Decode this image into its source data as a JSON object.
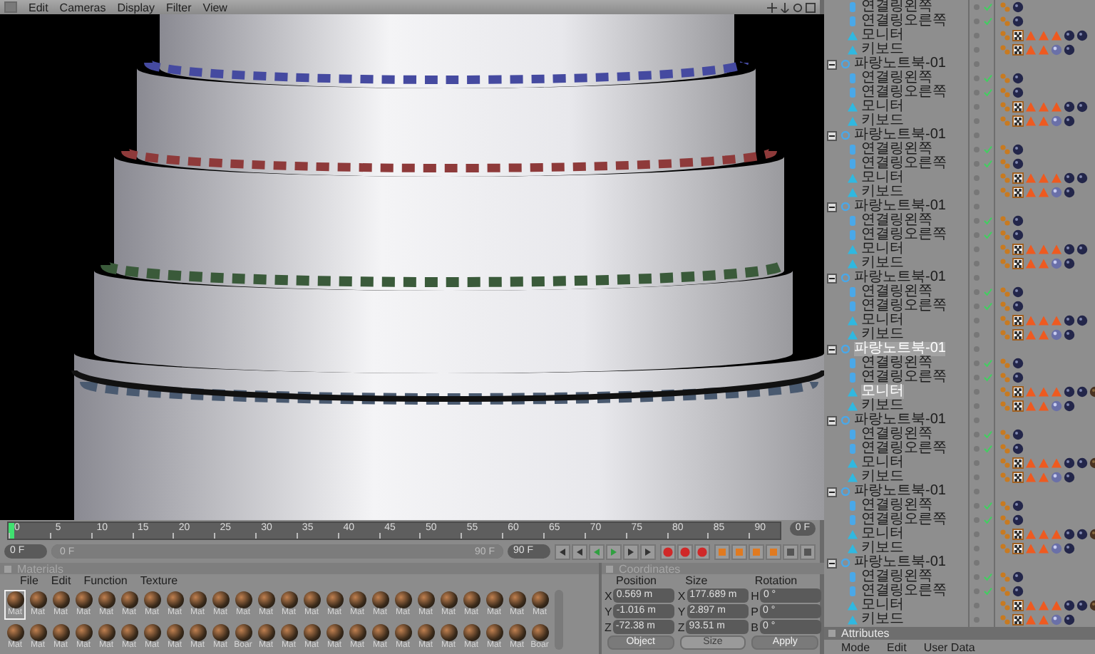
{
  "viewport": {
    "menu": [
      "Edit",
      "Cameras",
      "Display",
      "Filter",
      "View"
    ]
  },
  "timeline": {
    "ticks": [
      "0",
      "5",
      "10",
      "15",
      "20",
      "25",
      "30",
      "35",
      "40",
      "45",
      "50",
      "55",
      "60",
      "65",
      "70",
      "75",
      "80",
      "85",
      "90"
    ],
    "playhead": {
      "level": 0
    },
    "current_frame": "0 F",
    "start_field": "0 F",
    "range": {
      "start": "0 F",
      "end": "90 F",
      "level": 1
    },
    "end_field": "90 F"
  },
  "materials": {
    "title": "Materials",
    "menu": [
      "File",
      "Edit",
      "Function",
      "Texture"
    ],
    "items": [
      {
        "name": "Mat",
        "selected": true
      },
      {
        "name": "Mat",
        "selected": false
      },
      {
        "name": "Mat",
        "selected": false
      },
      {
        "name": "Mat",
        "selected": false
      },
      {
        "name": "Mat",
        "selected": false
      },
      {
        "name": "Mat",
        "selected": false
      },
      {
        "name": "Mat",
        "selected": false
      },
      {
        "name": "Mat",
        "selected": false
      },
      {
        "name": "Mat",
        "selected": false
      },
      {
        "name": "Mat",
        "selected": false
      },
      {
        "name": "Mat",
        "selected": false
      },
      {
        "name": "Mat",
        "selected": false
      },
      {
        "name": "Mat",
        "selected": false
      },
      {
        "name": "Mat",
        "selected": false
      },
      {
        "name": "Mat",
        "selected": false
      },
      {
        "name": "Mat",
        "selected": false
      },
      {
        "name": "Mat",
        "selected": false
      },
      {
        "name": "Mat",
        "selected": false
      },
      {
        "name": "Mat",
        "selected": false
      },
      {
        "name": "Mat",
        "selected": false
      },
      {
        "name": "Mat",
        "selected": false
      },
      {
        "name": "Mat",
        "selected": false
      },
      {
        "name": "Mat",
        "selected": false
      },
      {
        "name": "Mat",
        "selected": false
      },
      {
        "name": "Mat",
        "selected": false
      },
      {
        "name": "Mat",
        "selected": false
      },
      {
        "name": "Mat",
        "selected": false
      },
      {
        "name": "Mat",
        "selected": false
      },
      {
        "name": "Mat",
        "selected": false
      },
      {
        "name": "Mat",
        "selected": false
      },
      {
        "name": "Mat",
        "selected": false
      },
      {
        "name": "Mat",
        "selected": false
      },
      {
        "name": "Mat",
        "selected": false
      },
      {
        "name": "Mat",
        "selected": false
      },
      {
        "name": "Boar",
        "selected": false
      },
      {
        "name": "Mat",
        "selected": false
      },
      {
        "name": "Mat",
        "selected": false
      },
      {
        "name": "Mat",
        "selected": false
      },
      {
        "name": "Mat",
        "selected": false
      },
      {
        "name": "Mat",
        "selected": false
      },
      {
        "name": "Mat",
        "selected": false
      },
      {
        "name": "Mat",
        "selected": false
      },
      {
        "name": "Mat",
        "selected": false
      },
      {
        "name": "Mat",
        "selected": false
      },
      {
        "name": "Mat",
        "selected": false
      },
      {
        "name": "Mat",
        "selected": false
      },
      {
        "name": "Mat",
        "selected": false
      },
      {
        "name": "Boar",
        "selected": false
      }
    ]
  },
  "coordinates": {
    "title": "Coordinates",
    "columns": [
      "Position",
      "Size",
      "Rotation"
    ],
    "rows": [
      [
        {
          "axis": "X",
          "value": "0.569 m"
        },
        {
          "axis": "X",
          "value": "177.689 m"
        },
        {
          "axis": "H",
          "value": "0 °"
        }
      ],
      [
        {
          "axis": "Y",
          "value": "-1.016 m"
        },
        {
          "axis": "Y",
          "value": "2.897 m"
        },
        {
          "axis": "P",
          "value": "0 °"
        }
      ],
      [
        {
          "axis": "Z",
          "value": "-72.38 m"
        },
        {
          "axis": "Z",
          "value": "93.51 m"
        },
        {
          "axis": "B",
          "value": "0 °"
        }
      ]
    ],
    "mode_dropdown": {
      "value": "Object",
      "disabled": false
    },
    "size_dropdown": {
      "value": "Size",
      "disabled": true
    },
    "apply_button": "Apply"
  },
  "object_tree": {
    "items": [
      {
        "children": [
          {
            "name": "연결링왼쪽",
            "kind": "cylinder",
            "checked": true,
            "selected": false,
            "tags": [
              {
                "kind": "dots"
              },
              {
                "kind": "sphere"
              }
            ]
          },
          {
            "name": "연결링오른쪽",
            "kind": "cylinder",
            "checked": true,
            "selected": false,
            "tags": [
              {
                "kind": "dots"
              },
              {
                "kind": "sphere"
              }
            ]
          },
          {
            "name": "모니터",
            "kind": "mesh",
            "checked": false,
            "selected": false,
            "tags": [
              {
                "kind": "dots"
              },
              {
                "kind": "checker"
              },
              {
                "kind": "cone"
              },
              {
                "kind": "cone"
              },
              {
                "kind": "cone"
              },
              {
                "kind": "sphere"
              },
              {
                "kind": "sphere"
              }
            ]
          },
          {
            "name": "키보드",
            "kind": "mesh",
            "checked": false,
            "selected": false,
            "tags": [
              {
                "kind": "dots"
              },
              {
                "kind": "checker"
              },
              {
                "kind": "cone"
              },
              {
                "kind": "cone"
              },
              {
                "kind": "light"
              },
              {
                "kind": "sphere"
              }
            ]
          }
        ]
      },
      {
        "name": "파랑노트북-01",
        "kind": "null",
        "expanded": true,
        "selected": false,
        "children": [
          {
            "name": "연결링왼쪽",
            "kind": "cylinder",
            "checked": true,
            "selected": false,
            "tags": [
              {
                "kind": "dots"
              },
              {
                "kind": "sphere"
              }
            ]
          },
          {
            "name": "연결링오른쪽",
            "kind": "cylinder",
            "checked": true,
            "selected": false,
            "tags": [
              {
                "kind": "dots"
              },
              {
                "kind": "sphere"
              }
            ]
          },
          {
            "name": "모니터",
            "kind": "mesh",
            "checked": false,
            "selected": false,
            "tags": [
              {
                "kind": "dots"
              },
              {
                "kind": "checker"
              },
              {
                "kind": "cone"
              },
              {
                "kind": "cone"
              },
              {
                "kind": "cone"
              },
              {
                "kind": "sphere"
              },
              {
                "kind": "sphere"
              }
            ]
          },
          {
            "name": "키보드",
            "kind": "mesh",
            "checked": false,
            "selected": false,
            "tags": [
              {
                "kind": "dots"
              },
              {
                "kind": "checker"
              },
              {
                "kind": "cone"
              },
              {
                "kind": "cone"
              },
              {
                "kind": "light"
              },
              {
                "kind": "sphere"
              }
            ]
          }
        ]
      },
      {
        "name": "파랑노트북-01",
        "kind": "null",
        "expanded": true,
        "selected": false,
        "children": [
          {
            "name": "연결링왼쪽",
            "kind": "cylinder",
            "checked": true,
            "selected": false,
            "tags": [
              {
                "kind": "dots"
              },
              {
                "kind": "sphere"
              }
            ]
          },
          {
            "name": "연결링오른쪽",
            "kind": "cylinder",
            "checked": true,
            "selected": false,
            "tags": [
              {
                "kind": "dots"
              },
              {
                "kind": "sphere"
              }
            ]
          },
          {
            "name": "모니터",
            "kind": "mesh",
            "checked": false,
            "selected": false,
            "tags": [
              {
                "kind": "dots"
              },
              {
                "kind": "checker"
              },
              {
                "kind": "cone"
              },
              {
                "kind": "cone"
              },
              {
                "kind": "cone"
              },
              {
                "kind": "sphere"
              },
              {
                "kind": "sphere"
              }
            ]
          },
          {
            "name": "키보드",
            "kind": "mesh",
            "checked": false,
            "selected": false,
            "tags": [
              {
                "kind": "dots"
              },
              {
                "kind": "checker"
              },
              {
                "kind": "cone"
              },
              {
                "kind": "cone"
              },
              {
                "kind": "light"
              },
              {
                "kind": "sphere"
              }
            ]
          }
        ]
      },
      {
        "name": "파랑노트북-01",
        "kind": "null",
        "expanded": true,
        "selected": false,
        "children": [
          {
            "name": "연결링왼쪽",
            "kind": "cylinder",
            "checked": true,
            "selected": false,
            "tags": [
              {
                "kind": "dots"
              },
              {
                "kind": "sphere"
              }
            ]
          },
          {
            "name": "연결링오른쪽",
            "kind": "cylinder",
            "checked": true,
            "selected": false,
            "tags": [
              {
                "kind": "dots"
              },
              {
                "kind": "sphere"
              }
            ]
          },
          {
            "name": "모니터",
            "kind": "mesh",
            "checked": false,
            "selected": false,
            "tags": [
              {
                "kind": "dots"
              },
              {
                "kind": "checker"
              },
              {
                "kind": "cone"
              },
              {
                "kind": "cone"
              },
              {
                "kind": "cone"
              },
              {
                "kind": "sphere"
              },
              {
                "kind": "sphere"
              }
            ]
          },
          {
            "name": "키보드",
            "kind": "mesh",
            "checked": false,
            "selected": false,
            "tags": [
              {
                "kind": "dots"
              },
              {
                "kind": "checker"
              },
              {
                "kind": "cone"
              },
              {
                "kind": "cone"
              },
              {
                "kind": "light"
              },
              {
                "kind": "sphere"
              }
            ]
          }
        ]
      },
      {
        "name": "파랑노트북-01",
        "kind": "null",
        "expanded": true,
        "selected": false,
        "children": [
          {
            "name": "연결링왼쪽",
            "kind": "cylinder",
            "checked": true,
            "selected": false,
            "tags": [
              {
                "kind": "dots"
              },
              {
                "kind": "sphere"
              }
            ]
          },
          {
            "name": "연결링오른쪽",
            "kind": "cylinder",
            "checked": true,
            "selected": false,
            "tags": [
              {
                "kind": "dots"
              },
              {
                "kind": "sphere"
              }
            ]
          },
          {
            "name": "모니터",
            "kind": "mesh",
            "checked": false,
            "selected": false,
            "tags": [
              {
                "kind": "dots"
              },
              {
                "kind": "checker"
              },
              {
                "kind": "cone"
              },
              {
                "kind": "cone"
              },
              {
                "kind": "cone"
              },
              {
                "kind": "sphere"
              },
              {
                "kind": "sphere"
              }
            ]
          },
          {
            "name": "키보드",
            "kind": "mesh",
            "checked": false,
            "selected": false,
            "tags": [
              {
                "kind": "dots"
              },
              {
                "kind": "checker"
              },
              {
                "kind": "cone"
              },
              {
                "kind": "cone"
              },
              {
                "kind": "light"
              },
              {
                "kind": "sphere"
              }
            ]
          }
        ]
      },
      {
        "name": "파랑노트북-01",
        "kind": "null",
        "expanded": true,
        "selected": true,
        "children": [
          {
            "name": "연결링왼쪽",
            "kind": "cylinder",
            "checked": true,
            "selected": false,
            "tags": [
              {
                "kind": "dots"
              },
              {
                "kind": "sphere"
              }
            ]
          },
          {
            "name": "연결링오른쪽",
            "kind": "cylinder",
            "checked": true,
            "selected": false,
            "tags": [
              {
                "kind": "dots"
              },
              {
                "kind": "sphere"
              }
            ]
          },
          {
            "name": "모니터",
            "kind": "mesh",
            "checked": false,
            "selected": true,
            "tags": [
              {
                "kind": "dots"
              },
              {
                "kind": "checker"
              },
              {
                "kind": "cone"
              },
              {
                "kind": "cone"
              },
              {
                "kind": "cone"
              },
              {
                "kind": "sphere"
              },
              {
                "kind": "sphere"
              },
              {
                "kind": "texture"
              }
            ]
          },
          {
            "name": "키보드",
            "kind": "mesh",
            "checked": false,
            "selected": false,
            "tags": [
              {
                "kind": "dots"
              },
              {
                "kind": "checker"
              },
              {
                "kind": "cone"
              },
              {
                "kind": "cone"
              },
              {
                "kind": "light"
              },
              {
                "kind": "sphere"
              }
            ]
          }
        ]
      },
      {
        "name": "파랑노트북-01",
        "kind": "null",
        "expanded": true,
        "selected": false,
        "children": [
          {
            "name": "연결링왼쪽",
            "kind": "cylinder",
            "checked": true,
            "selected": false,
            "tags": [
              {
                "kind": "dots"
              },
              {
                "kind": "sphere"
              }
            ]
          },
          {
            "name": "연결링오른쪽",
            "kind": "cylinder",
            "checked": true,
            "selected": false,
            "tags": [
              {
                "kind": "dots"
              },
              {
                "kind": "sphere"
              }
            ]
          },
          {
            "name": "모니터",
            "kind": "mesh",
            "checked": false,
            "selected": false,
            "tags": [
              {
                "kind": "dots"
              },
              {
                "kind": "checker"
              },
              {
                "kind": "cone"
              },
              {
                "kind": "cone"
              },
              {
                "kind": "cone"
              },
              {
                "kind": "sphere"
              },
              {
                "kind": "sphere"
              },
              {
                "kind": "texture"
              }
            ]
          },
          {
            "name": "키보드",
            "kind": "mesh",
            "checked": false,
            "selected": false,
            "tags": [
              {
                "kind": "dots"
              },
              {
                "kind": "checker"
              },
              {
                "kind": "cone"
              },
              {
                "kind": "cone"
              },
              {
                "kind": "light"
              },
              {
                "kind": "sphere"
              }
            ]
          }
        ]
      },
      {
        "name": "파랑노트북-01",
        "kind": "null",
        "expanded": true,
        "selected": false,
        "children": [
          {
            "name": "연결링왼쪽",
            "kind": "cylinder",
            "checked": true,
            "selected": false,
            "tags": [
              {
                "kind": "dots"
              },
              {
                "kind": "sphere"
              }
            ]
          },
          {
            "name": "연결링오른쪽",
            "kind": "cylinder",
            "checked": true,
            "selected": false,
            "tags": [
              {
                "kind": "dots"
              },
              {
                "kind": "sphere"
              }
            ]
          },
          {
            "name": "모니터",
            "kind": "mesh",
            "checked": false,
            "selected": false,
            "tags": [
              {
                "kind": "dots"
              },
              {
                "kind": "checker"
              },
              {
                "kind": "cone"
              },
              {
                "kind": "cone"
              },
              {
                "kind": "cone"
              },
              {
                "kind": "sphere"
              },
              {
                "kind": "sphere"
              },
              {
                "kind": "texture"
              }
            ]
          },
          {
            "name": "키보드",
            "kind": "mesh",
            "checked": false,
            "selected": false,
            "tags": [
              {
                "kind": "dots"
              },
              {
                "kind": "checker"
              },
              {
                "kind": "cone"
              },
              {
                "kind": "cone"
              },
              {
                "kind": "light"
              },
              {
                "kind": "sphere"
              }
            ]
          }
        ]
      },
      {
        "name": "파랑노트북-01",
        "kind": "null",
        "expanded": true,
        "selected": false,
        "children": [
          {
            "name": "연결링왼쪽",
            "kind": "cylinder",
            "checked": true,
            "selected": false,
            "tags": [
              {
                "kind": "dots"
              },
              {
                "kind": "sphere"
              }
            ]
          },
          {
            "name": "연결링오른쪽",
            "kind": "cylinder",
            "checked": true,
            "selected": false,
            "tags": [
              {
                "kind": "dots"
              },
              {
                "kind": "sphere"
              }
            ]
          },
          {
            "name": "모니터",
            "kind": "mesh",
            "checked": false,
            "selected": false,
            "tags": [
              {
                "kind": "dots"
              },
              {
                "kind": "checker"
              },
              {
                "kind": "cone"
              },
              {
                "kind": "cone"
              },
              {
                "kind": "cone"
              },
              {
                "kind": "sphere"
              },
              {
                "kind": "sphere"
              },
              {
                "kind": "texture"
              }
            ]
          },
          {
            "name": "키보드",
            "kind": "mesh",
            "checked": false,
            "selected": false,
            "tags": [
              {
                "kind": "dots"
              },
              {
                "kind": "checker"
              },
              {
                "kind": "cone"
              },
              {
                "kind": "cone"
              },
              {
                "kind": "light"
              },
              {
                "kind": "sphere"
              }
            ]
          }
        ]
      }
    ]
  },
  "attributes": {
    "title": "Attributes",
    "menu": [
      "Mode",
      "Edit",
      "User Data"
    ]
  }
}
